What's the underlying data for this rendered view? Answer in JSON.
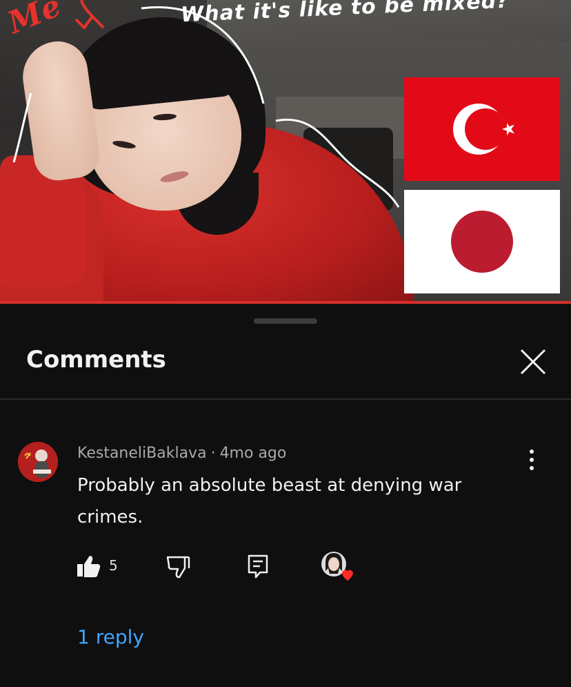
{
  "thumbnail": {
    "title_overlay": "What it's like to be mixed?",
    "me_label": "Me",
    "flags": [
      "turkey-flag",
      "japan-flag"
    ],
    "colors": {
      "hoodie": "#c92725",
      "flag_red": "#e30a17",
      "progress": "#d9302b"
    }
  },
  "sheet": {
    "title": "Comments",
    "close_icon": "close-icon"
  },
  "comment": {
    "author": "KestaneliBaklava",
    "separator": "·",
    "age": "4mo ago",
    "text": "Probably an absolute beast at denying war crimes.",
    "like_count": "5",
    "icons": [
      "thumbs-up-icon",
      "thumbs-down-icon",
      "reply-icon",
      "creator-heart-icon",
      "more-vert-icon"
    ]
  },
  "replies": {
    "label": "1 reply"
  },
  "colors": {
    "background": "#0f0f0f",
    "text": "#f1f1f1",
    "meta": "#aaaaaa",
    "link": "#3ea6ff"
  }
}
